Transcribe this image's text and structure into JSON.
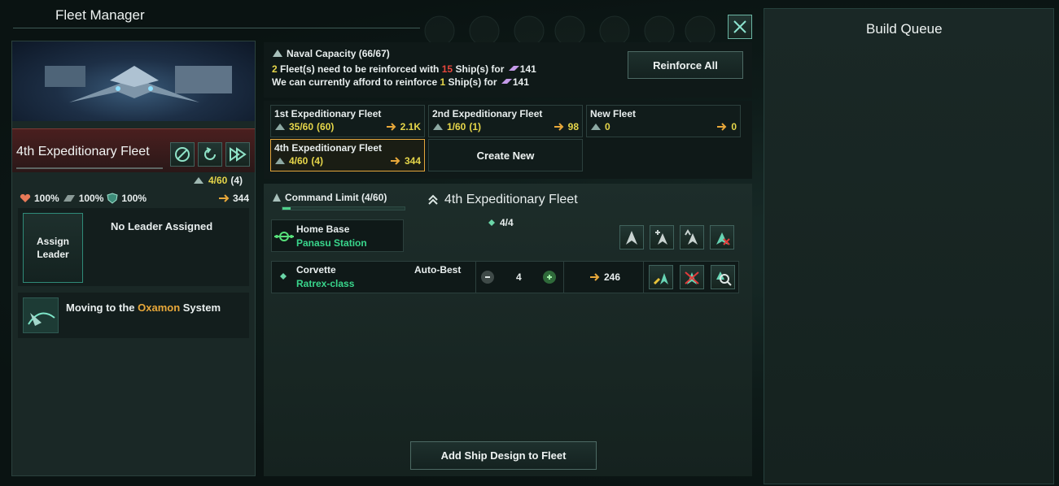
{
  "colors": {
    "accent_yellow": "#e6d64a",
    "accent_red": "#e8473d",
    "accent_orange": "#e8a83a",
    "accent_green": "#5ed06a",
    "selected_border": "#e4a63c"
  },
  "window": {
    "title": "Fleet Manager",
    "close_icon": "close-icon"
  },
  "build_queue": {
    "title": "Build Queue"
  },
  "fleet_header": {
    "name": "4th Expeditionary Fleet",
    "ships": "4/60",
    "ships_paren": "(4)",
    "hull": "100%",
    "armor": "100%",
    "shield": "100%",
    "power": "344"
  },
  "leader": {
    "assign_label": "Assign Leader",
    "status": "No Leader Assigned"
  },
  "order": {
    "prefix": "Moving to the",
    "system": "Oxamon",
    "suffix": "System"
  },
  "naval": {
    "title": "Naval Capacity (66/67)",
    "line1_count": "2",
    "line1_a": "Fleet(s) need to be reinforced with",
    "line1_ships": "15",
    "line1_b": "Ship(s) for",
    "line1_cost": "141",
    "line2_a": "We can currently afford to reinforce",
    "line2_ships": "1",
    "line2_b": "Ship(s) for",
    "line2_cost": "141",
    "reinforce_all": "Reinforce All"
  },
  "fleets": [
    {
      "name": "1st Expeditionary Fleet",
      "count": "35/60",
      "count_paren": "(60)",
      "power": "2.1K"
    },
    {
      "name": "2nd Expeditionary Fleet",
      "count": "1/60",
      "count_paren": "(1)",
      "power": "98"
    },
    {
      "name": "New Fleet",
      "count": "0",
      "count_paren": "",
      "power": "0"
    },
    {
      "name": "4th Expeditionary Fleet",
      "count": "4/60",
      "count_paren": "(4)",
      "power": "344"
    }
  ],
  "create_new": "Create New",
  "detail": {
    "command_limit": "Command Limit (4/60)",
    "command_fill": 0.0667,
    "fleet_name": "4th Expeditionary Fleet",
    "composition": "4/4",
    "home_base_label": "Home Base",
    "home_base_value": "Panasu Station",
    "ship_class": "Corvette",
    "ship_design": "Ratrex-class",
    "auto_best": "Auto-Best",
    "quantity": "4",
    "ship_power": "246",
    "add_design": "Add Ship Design to Fleet"
  }
}
